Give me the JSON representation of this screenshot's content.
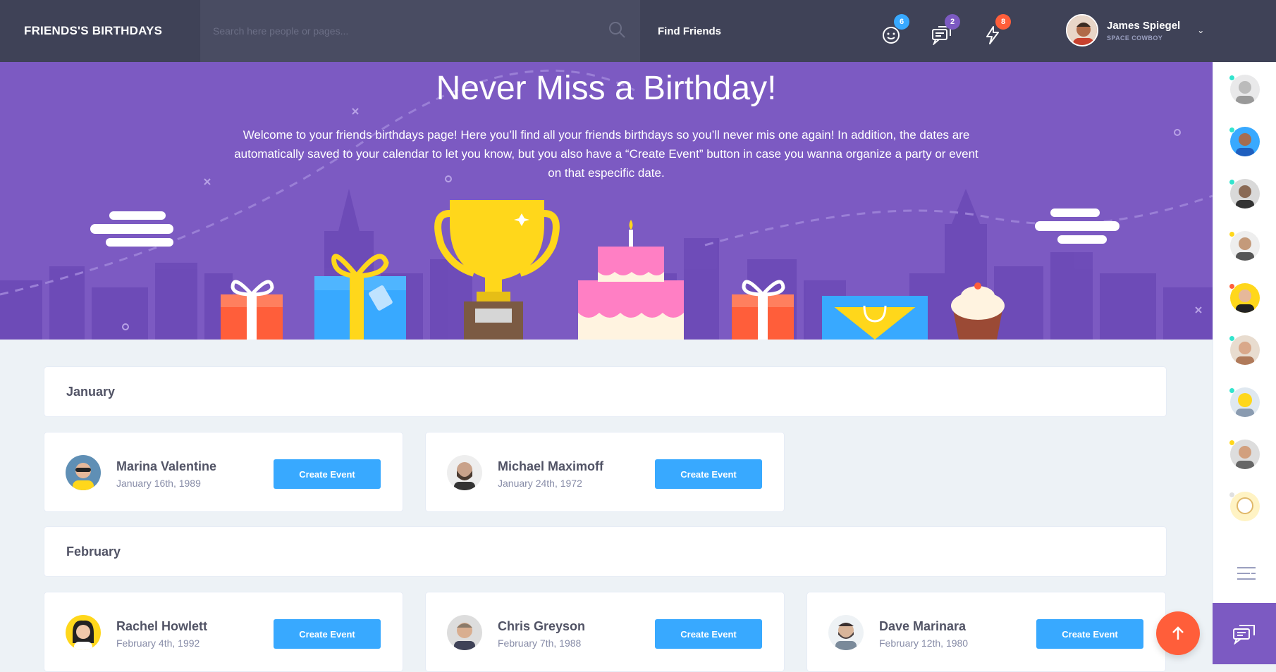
{
  "topbar": {
    "brand": "FRIENDS'S BIRTHDAYS",
    "search_placeholder": "Search here people or pages...",
    "find_friends": "Find Friends",
    "badges": {
      "friends": "6",
      "messages": "2",
      "activity": "8"
    },
    "user_name": "James Spiegel",
    "user_role": "SPACE COWBOY"
  },
  "hero": {
    "title": "Never Miss a Birthday!",
    "text": "Welcome to your friends birthdays page! Here you’ll find all your friends birthdays so you’ll never mis one again! In addition, the dates are automatically saved to your calendar to let you know, but you also have a “Create Event” button in case you wanna organize a party or event on that especific date."
  },
  "months": [
    {
      "name": "January",
      "friends": [
        {
          "name": "Marina Valentine",
          "date": "January 16th, 1989",
          "button": "Create Event"
        },
        {
          "name": "Michael Maximoff",
          "date": "January 24th, 1972",
          "button": "Create Event"
        }
      ]
    },
    {
      "name": "February",
      "friends": [
        {
          "name": "Rachel Howlett",
          "date": "February 4th, 1992",
          "button": "Create Event"
        },
        {
          "name": "Chris Greyson",
          "date": "February 7th, 1988",
          "button": "Create Event"
        },
        {
          "name": "Dave Marinara",
          "date": "February 12th, 1980",
          "button": "Create Event"
        }
      ]
    }
  ],
  "colors": {
    "topbar": "#3f4257",
    "hero": "#7c5ac2",
    "button": "#38a9ff",
    "fab": "#ff5e3a",
    "badge_friends": "#38a9ff",
    "badge_messages": "#7c5ac2",
    "badge_activity": "#ff5e3a",
    "online": "#32e4cd"
  },
  "icons": {
    "search": "search-icon",
    "friends": "happy-face-icon",
    "messages": "chat-messages-icon",
    "activity": "thunder-icon",
    "menu": "menu-lines-icon",
    "chat": "chat-icon",
    "scroll_top": "arrow-up-icon"
  }
}
